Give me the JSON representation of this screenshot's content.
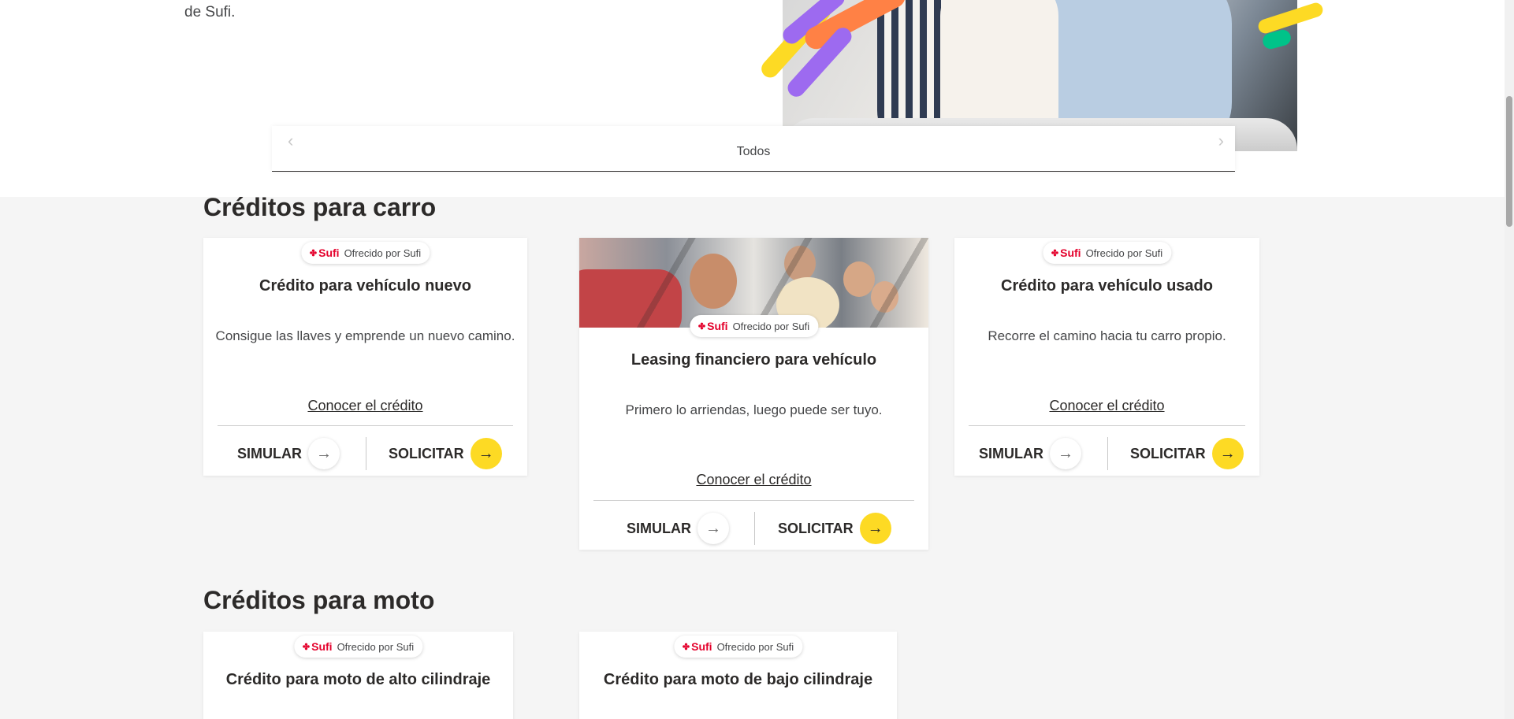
{
  "intro": {
    "text_tail": "de Sufi."
  },
  "carousel": {
    "tab_label": "Todos",
    "prev_icon": "chevron-left-icon",
    "next_icon": "chevron-right-icon"
  },
  "sections": {
    "carro": {
      "title": "Créditos para carro",
      "cards": [
        {
          "badge_brand": "Sufi",
          "badge_text": "Ofrecido por Sufi",
          "title": "Crédito para vehículo nuevo",
          "description": "Consigue las llaves y emprende un nuevo camino.",
          "link": "Conocer el crédito",
          "simulate": "SIMULAR",
          "apply": "SOLICITAR"
        },
        {
          "badge_brand": "Sufi",
          "badge_text": "Ofrecido por Sufi",
          "title": "Leasing financiero para vehículo",
          "description": "Primero lo arriendas, luego puede ser tuyo.",
          "link": "Conocer el crédito",
          "simulate": "SIMULAR",
          "apply": "SOLICITAR"
        },
        {
          "badge_brand": "Sufi",
          "badge_text": "Ofrecido por Sufi",
          "title": "Crédito para vehículo usado",
          "description": "Recorre el camino hacia tu carro propio.",
          "link": "Conocer el crédito",
          "simulate": "SIMULAR",
          "apply": "SOLICITAR"
        }
      ]
    },
    "moto": {
      "title": "Créditos para moto",
      "cards": [
        {
          "badge_brand": "Sufi",
          "badge_text": "Ofrecido por Sufi",
          "title": "Crédito para moto de alto cilindraje"
        },
        {
          "badge_brand": "Sufi",
          "badge_text": "Ofrecido por Sufi",
          "title": "Crédito para moto de bajo cilindraje"
        }
      ]
    }
  },
  "icons": {
    "arrow": "arrow-right-icon",
    "brand_mark": "sufi-logo-icon"
  },
  "colors": {
    "accent_yellow": "#fdda24",
    "brand_red": "#e4002b",
    "text": "#2c2a29",
    "background": "#f5f5f5"
  }
}
